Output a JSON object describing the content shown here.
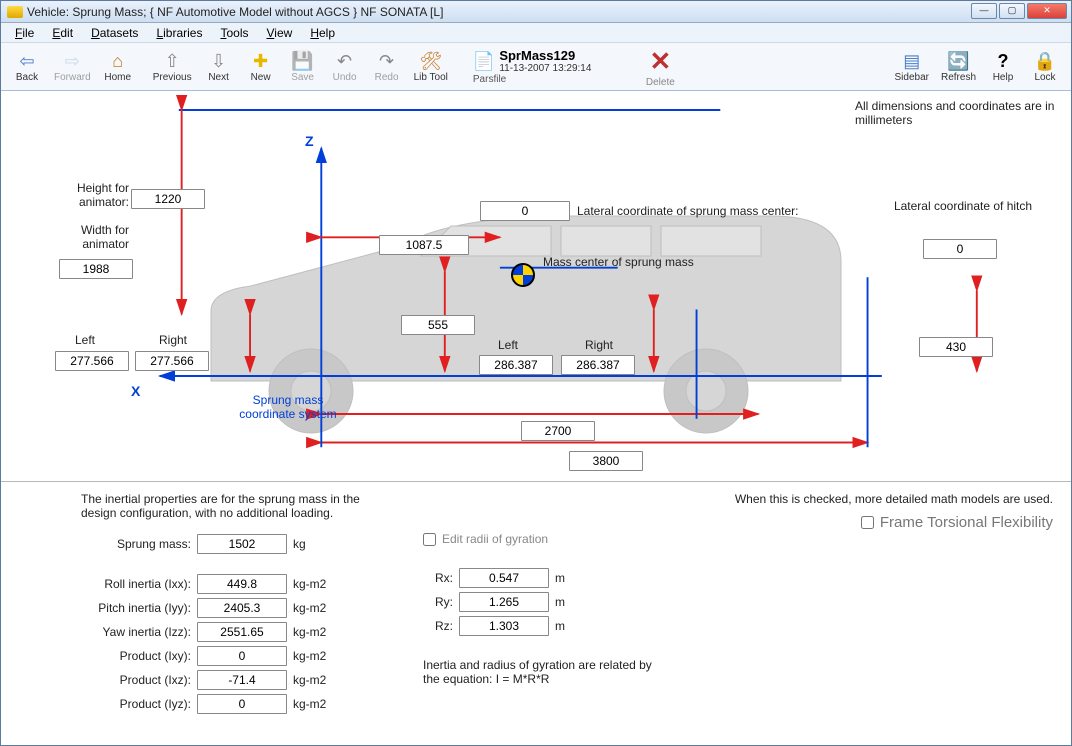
{
  "window": {
    "title": "Vehicle: Sprung Mass;   { NF Automotive Model without AGCS }   NF SONATA [L]"
  },
  "menus": {
    "file": "File",
    "edit": "Edit",
    "datasets": "Datasets",
    "libraries": "Libraries",
    "tools": "Tools",
    "view": "View",
    "help": "Help"
  },
  "toolbar": {
    "back": "Back",
    "forward": "Forward",
    "home": "Home",
    "previous": "Previous",
    "next": "Next",
    "new": "New",
    "save": "Save",
    "undo": "Undo",
    "redo": "Redo",
    "libtool": "Lib Tool",
    "parsfile": "Parsfile",
    "delete": "Delete",
    "sidebar": "Sidebar",
    "refresh": "Refresh",
    "help": "Help",
    "lock": "Lock",
    "parsfile_name": "SprMass129",
    "parsfile_date": "11-13-2007 13:29:14"
  },
  "diagram": {
    "note": "All dimensions and coordinates are in millimeters",
    "height_for_animator_label": "Height for animator:",
    "height_for_animator_value": "1220",
    "width_for_animator_label": "Width for animator",
    "width_for_animator_value": "1988",
    "left_label": "Left",
    "right_label": "Right",
    "front_track_left": "277.566",
    "front_track_right": "277.566",
    "wheelbase_value": "1087.5",
    "cg_height_value": "555",
    "lateral_cg_label": "Lateral coordinate of sprung mass center:",
    "lateral_cg_value": "0",
    "mass_center_label": "Mass center of sprung mass",
    "rear_left_label": "Left",
    "rear_right_label": "Right",
    "rear_track_left": "286.387",
    "rear_track_right": "286.387",
    "wheelbase_2700": "2700",
    "overall_3800": "3800",
    "lateral_hitch_label": "Lateral coordinate of hitch",
    "lateral_hitch_value": "0",
    "hitch_height_value": "430",
    "coord_sys_label": "Sprung mass coordinate system",
    "axis_z": "Z",
    "axis_x": "X"
  },
  "bottom": {
    "intro": "The inertial properties are for the sprung mass in the design configuration, with no additional loading.",
    "sprung_mass_label": "Sprung mass:",
    "sprung_mass_value": "1502",
    "sprung_mass_unit": "kg",
    "roll_label": "Roll inertia (Ixx):",
    "roll_value": "449.8",
    "pitch_label": "Pitch inertia (Iyy):",
    "pitch_value": "2405.3",
    "yaw_label": "Yaw inertia (Izz):",
    "yaw_value": "2551.65",
    "pxy_label": "Product (Ixy):",
    "pxy_value": "0",
    "pxz_label": "Product (Ixz):",
    "pxz_value": "-71.4",
    "pyz_label": "Product (Iyz):",
    "pyz_value": "0",
    "inertia_unit": "kg-m2",
    "edit_radii_label": "Edit radii of gyration",
    "rx_label": "Rx:",
    "rx_value": "0.547",
    "ry_label": "Ry:",
    "ry_value": "1.265",
    "rz_label": "Rz:",
    "rz_value": "1.303",
    "r_unit": "m",
    "inertia_note": "Inertia and radius of gyration are related by the equation: I = M*R*R",
    "frame_hint": "When this is checked, more detailed math models are used.",
    "frame_check_label": "Frame Torsional Flexibility"
  }
}
